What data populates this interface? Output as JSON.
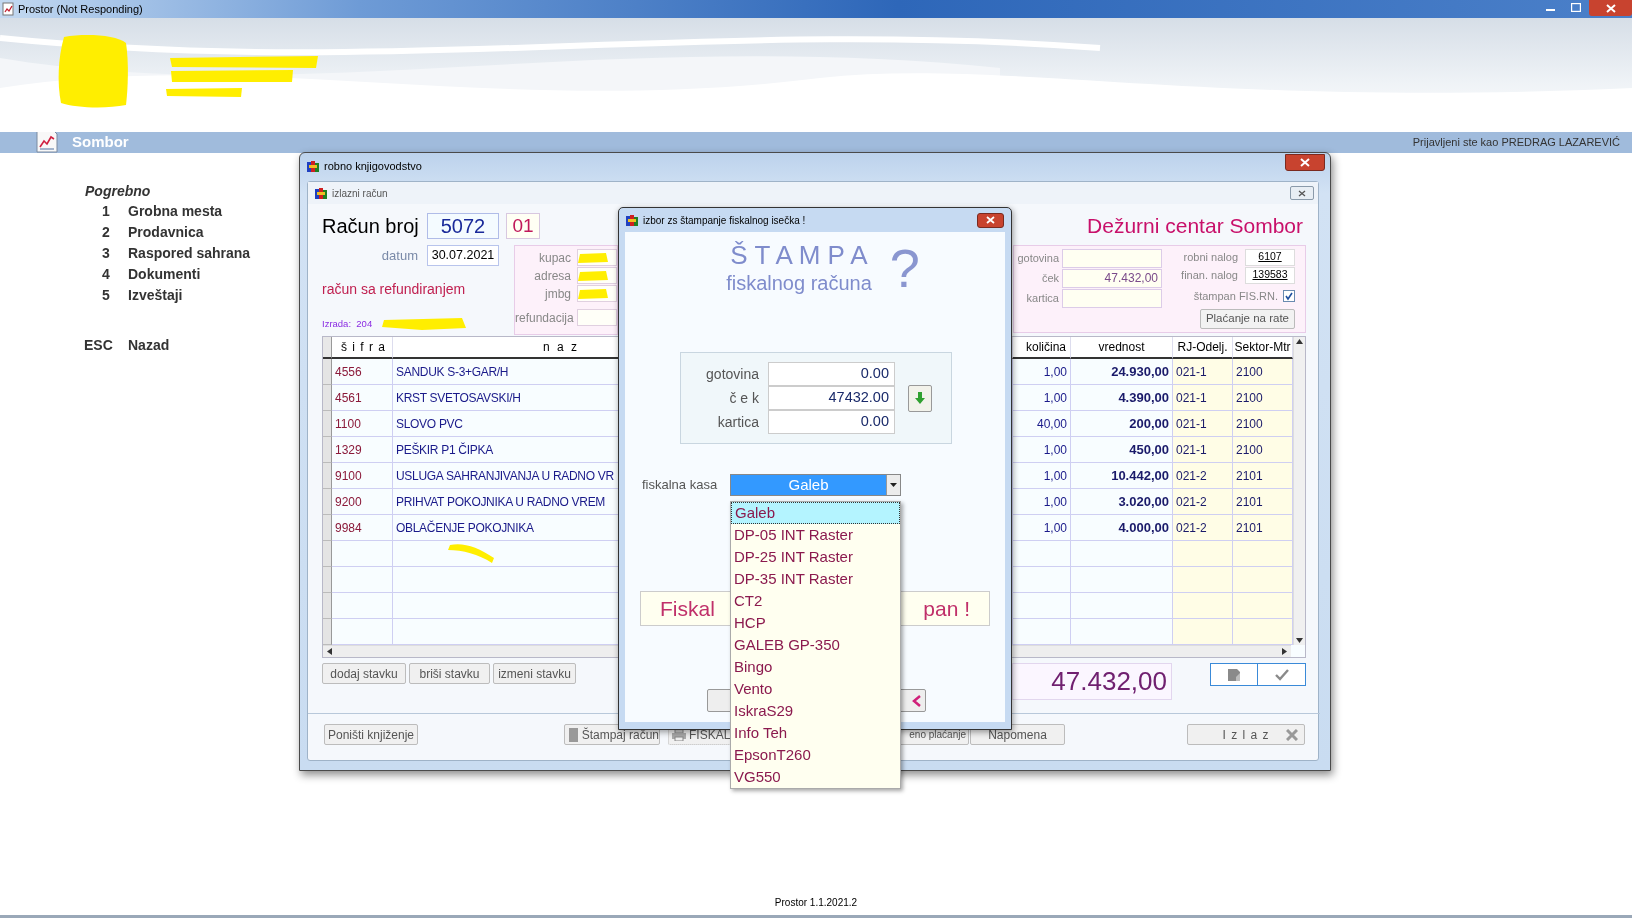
{
  "app_window": {
    "title": "Prostor (Not Responding)"
  },
  "location_bar": {
    "location": "Sombor",
    "login_text": "Prijavljeni ste kao PREDRAG LAZAREVIĆ"
  },
  "menu": {
    "title": "Pogrebno",
    "items": [
      {
        "key": "1",
        "label": "Grobna mesta"
      },
      {
        "key": "2",
        "label": "Prodavnica"
      },
      {
        "key": "3",
        "label": "Raspored sahrana"
      },
      {
        "key": "4",
        "label": "Dokumenti"
      },
      {
        "key": "5",
        "label": "Izveštaji"
      }
    ],
    "back": {
      "key": "ESC",
      "label": "Nazad"
    }
  },
  "accounting_window": {
    "title": "robno knjigovodstvo"
  },
  "invoice": {
    "panel_title": "izlazni račun",
    "heading": "Račun broj",
    "number": "5072",
    "suffix": "01",
    "date_label": "datum",
    "date": "30.07.2021",
    "type_note": "račun sa refundiranjem",
    "created_by": "Izrada:  204",
    "customer_labels": [
      "kupac",
      "adresa",
      "jmbg",
      "refundacija"
    ],
    "center": "Dežurni centar Sombor",
    "payment": [
      {
        "label": "gotovina"
      },
      {
        "label": "ček",
        "value": "47.432,00"
      },
      {
        "label": "kartica"
      }
    ],
    "orders": [
      {
        "label": "robni nalog",
        "value": "6107"
      },
      {
        "label": "finan. nalog",
        "value": "139583"
      }
    ],
    "printed": {
      "label": "štampan FIS.RN.",
      "checked": true
    },
    "installments_button": "Plaćanje na rate",
    "table": {
      "columns": [
        "š i f r a",
        "n a z",
        "količina",
        "vrednost",
        "RJ-Odelj.",
        "Sektor-Mtr"
      ],
      "rows": [
        [
          "4556",
          "SANDUK S-3+GAR/H",
          "1,00",
          "24.930,00",
          "021-1",
          "2100"
        ],
        [
          "4561",
          "KRST SVETOSAVSKI/H",
          "1,00",
          "4.390,00",
          "021-1",
          "2100"
        ],
        [
          "1100",
          "SLOVO PVC",
          "40,00",
          "200,00",
          "021-1",
          "2100"
        ],
        [
          "1329",
          "PEŠKIR P1 ČIPKA",
          "1,00",
          "450,00",
          "021-1",
          "2100"
        ],
        [
          "9100",
          "USLUGA SAHRANJIVANJA U RADNO VR",
          "1,00",
          "10.442,00",
          "021-2",
          "2101"
        ],
        [
          "9200",
          "PRIHVAT POKOJNIKA U RADNO VREM",
          "1,00",
          "3.020,00",
          "021-2",
          "2101"
        ],
        [
          "9984",
          "OBLAČENJE POKOJNIKA",
          "1,00",
          "4.000,00",
          "021-2",
          "2101"
        ]
      ]
    },
    "row_buttons": [
      "dodaj stavku",
      "briši stavku",
      "izmeni stavku"
    ],
    "total": "47.432,00",
    "bottom_buttons": {
      "cancel": "Poništi knjiženje",
      "print": "Štampaj račun",
      "fiscal": "FISKAL",
      "payment": "eno plaćanje",
      "note": "Napomena",
      "exit": "I z l a z"
    }
  },
  "dialog": {
    "title": "izbor zs štampanje fiskalnog isečka !",
    "heading": "Š T A M P A",
    "subheading": "fiskalnog računa",
    "mark": "?",
    "payments": [
      {
        "label": "gotovina",
        "value": "0.00"
      },
      {
        "label": "č e k",
        "value": "47432.00"
      },
      {
        "label": "kartica",
        "value": "0.00"
      }
    ],
    "register_label": "fiskalna kasa",
    "register_value": "Galeb",
    "options": [
      {
        "label": "Galeb",
        "selected": true
      },
      {
        "label": "DP-05 INT Raster",
        "selected": false
      },
      {
        "label": "DP-25 INT Raster",
        "selected": false
      },
      {
        "label": "DP-35 INT Raster",
        "selected": false
      },
      {
        "label": "CT2",
        "selected": false
      },
      {
        "label": "HCP",
        "selected": false
      },
      {
        "label": "GALEB GP-350",
        "selected": false
      },
      {
        "label": "Bingo",
        "selected": false
      },
      {
        "label": "Vento",
        "selected": false
      },
      {
        "label": "IskraS29",
        "selected": false
      },
      {
        "label": "Info Teh",
        "selected": false
      },
      {
        "label": "EpsonT260",
        "selected": false
      },
      {
        "label": "VG550",
        "selected": false
      }
    ],
    "message_start": "Fiskal",
    "message_end": "pan !"
  },
  "footer": {
    "version": "Prostor 1.1.2021.2"
  }
}
